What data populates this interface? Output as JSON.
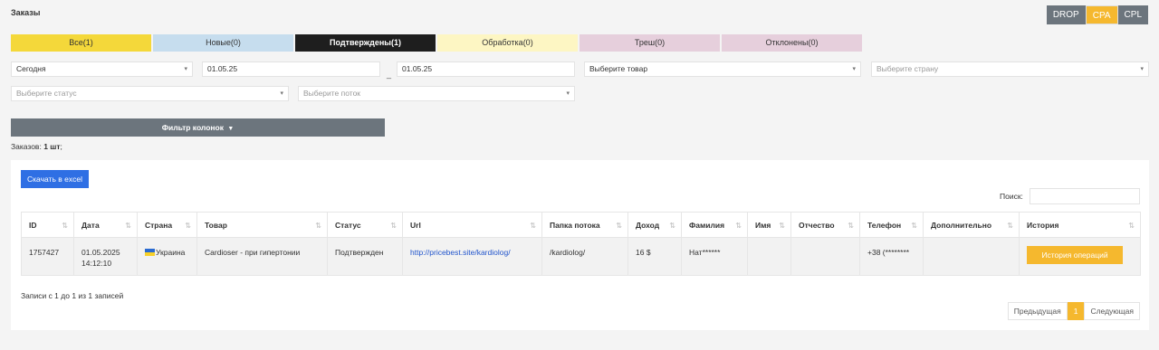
{
  "header": {
    "title": "Заказы"
  },
  "model_switch": {
    "items": [
      "DROP",
      "CPA",
      "CPL"
    ],
    "active": "CPA"
  },
  "tabs": [
    {
      "label": "Все(1)"
    },
    {
      "label": "Новые(0)"
    },
    {
      "label": "Подтверждены(1)"
    },
    {
      "label": "Обработка(0)"
    },
    {
      "label": "Треш(0)"
    },
    {
      "label": "Отклонены(0)"
    }
  ],
  "filters": {
    "period": "Сегодня",
    "date_from": "01.05.25",
    "date_to": "01.05.25",
    "product_placeholder": "Выберите товар",
    "country_placeholder": "Выберите страну",
    "status_placeholder": "Выберите статус",
    "stream_placeholder": "Выберите поток",
    "date_separator": "_"
  },
  "column_filter": {
    "label": "Фильтр колонок"
  },
  "orders_count": {
    "label": "Заказов:",
    "value": "1 шт"
  },
  "card": {
    "excel_label": "Скачать в excel",
    "search_label": "Поиск:"
  },
  "table": {
    "columns": [
      "ID",
      "Дата",
      "Страна",
      "Товар",
      "Статус",
      "Url",
      "Папка потока",
      "Доход",
      "Фамилия",
      "Имя",
      "Отчество",
      "Телефон",
      "Дополнительно",
      "История"
    ],
    "rows": [
      {
        "id": "1757427",
        "date": "01.05.2025",
        "time": "14:12:10",
        "country": "Украина",
        "product": "Cardioser - при гипертонии",
        "status": "Подтвержден",
        "url": "http://pricebest.site/kardiolog/",
        "folder": "/kardiolog/",
        "income": "16 $",
        "last_name": "Нат******",
        "first_name": "",
        "patronymic": "",
        "phone": "+38 (********",
        "extra": "",
        "history_label": "История операций"
      }
    ]
  },
  "records_info": "Записи с 1 до 1 из 1 записей",
  "pagination": {
    "prev": "Предыдущая",
    "current": "1",
    "next": "Следующая"
  },
  "colors": {
    "accent": "#f5b82e",
    "primary": "#2f6fe4",
    "dark": "#1e1e1e",
    "gray": "#6c757d"
  }
}
